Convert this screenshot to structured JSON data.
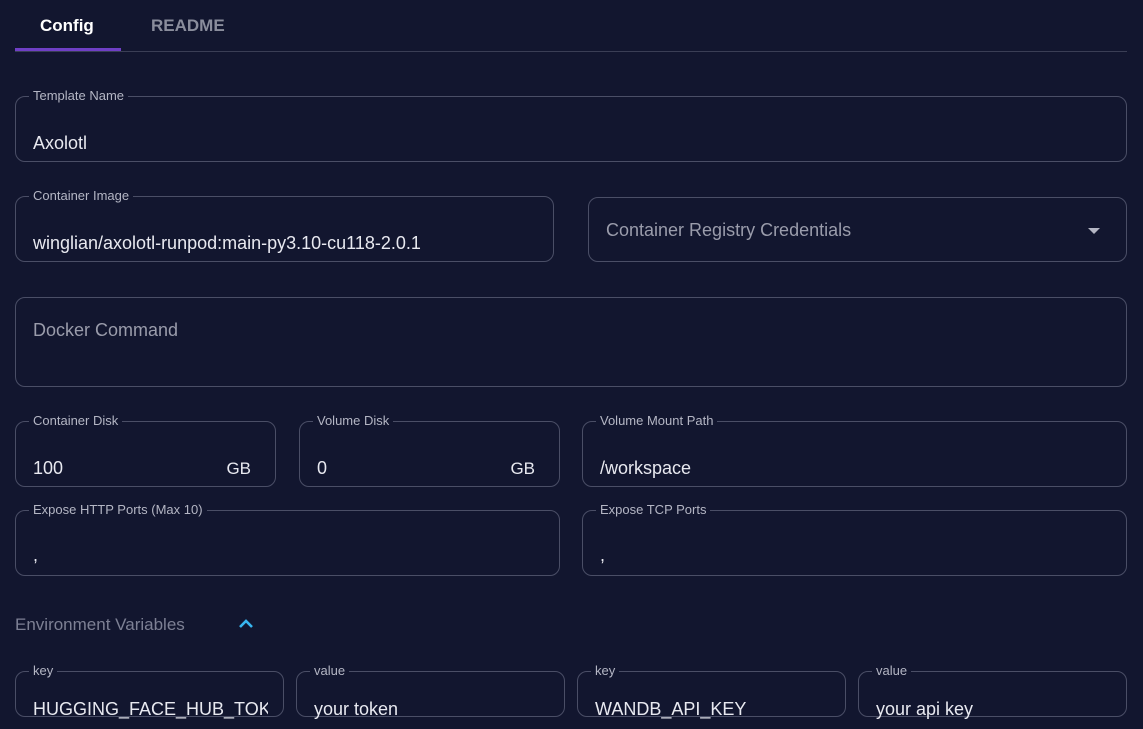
{
  "tabs": [
    {
      "label": "Config",
      "active": true
    },
    {
      "label": "README",
      "active": false
    }
  ],
  "template_name": {
    "label": "Template Name",
    "value": "Axolotl"
  },
  "container_image": {
    "label": "Container Image",
    "value": "winglian/axolotl-runpod:main-py3.10-cu118-2.0.1"
  },
  "registry": {
    "placeholder": "Container Registry Credentials"
  },
  "docker_command": {
    "placeholder": "Docker Command"
  },
  "container_disk": {
    "label": "Container Disk",
    "value": "100",
    "unit": "GB"
  },
  "volume_disk": {
    "label": "Volume Disk",
    "value": "0",
    "unit": "GB"
  },
  "volume_mount": {
    "label": "Volume Mount Path",
    "value": "/workspace"
  },
  "http_ports": {
    "label": "Expose HTTP Ports (Max 10)",
    "value": ","
  },
  "tcp_ports": {
    "label": "Expose TCP Ports",
    "value": ","
  },
  "env": {
    "title": "Environment Variables",
    "accent": "#38b6f0",
    "vars": [
      {
        "key_label": "key",
        "key": "HUGGING_FACE_HUB_TOKEN",
        "value_label": "value",
        "value": "your token"
      },
      {
        "key_label": "key",
        "key": "WANDB_API_KEY",
        "value_label": "value",
        "value": "your api key"
      }
    ]
  }
}
